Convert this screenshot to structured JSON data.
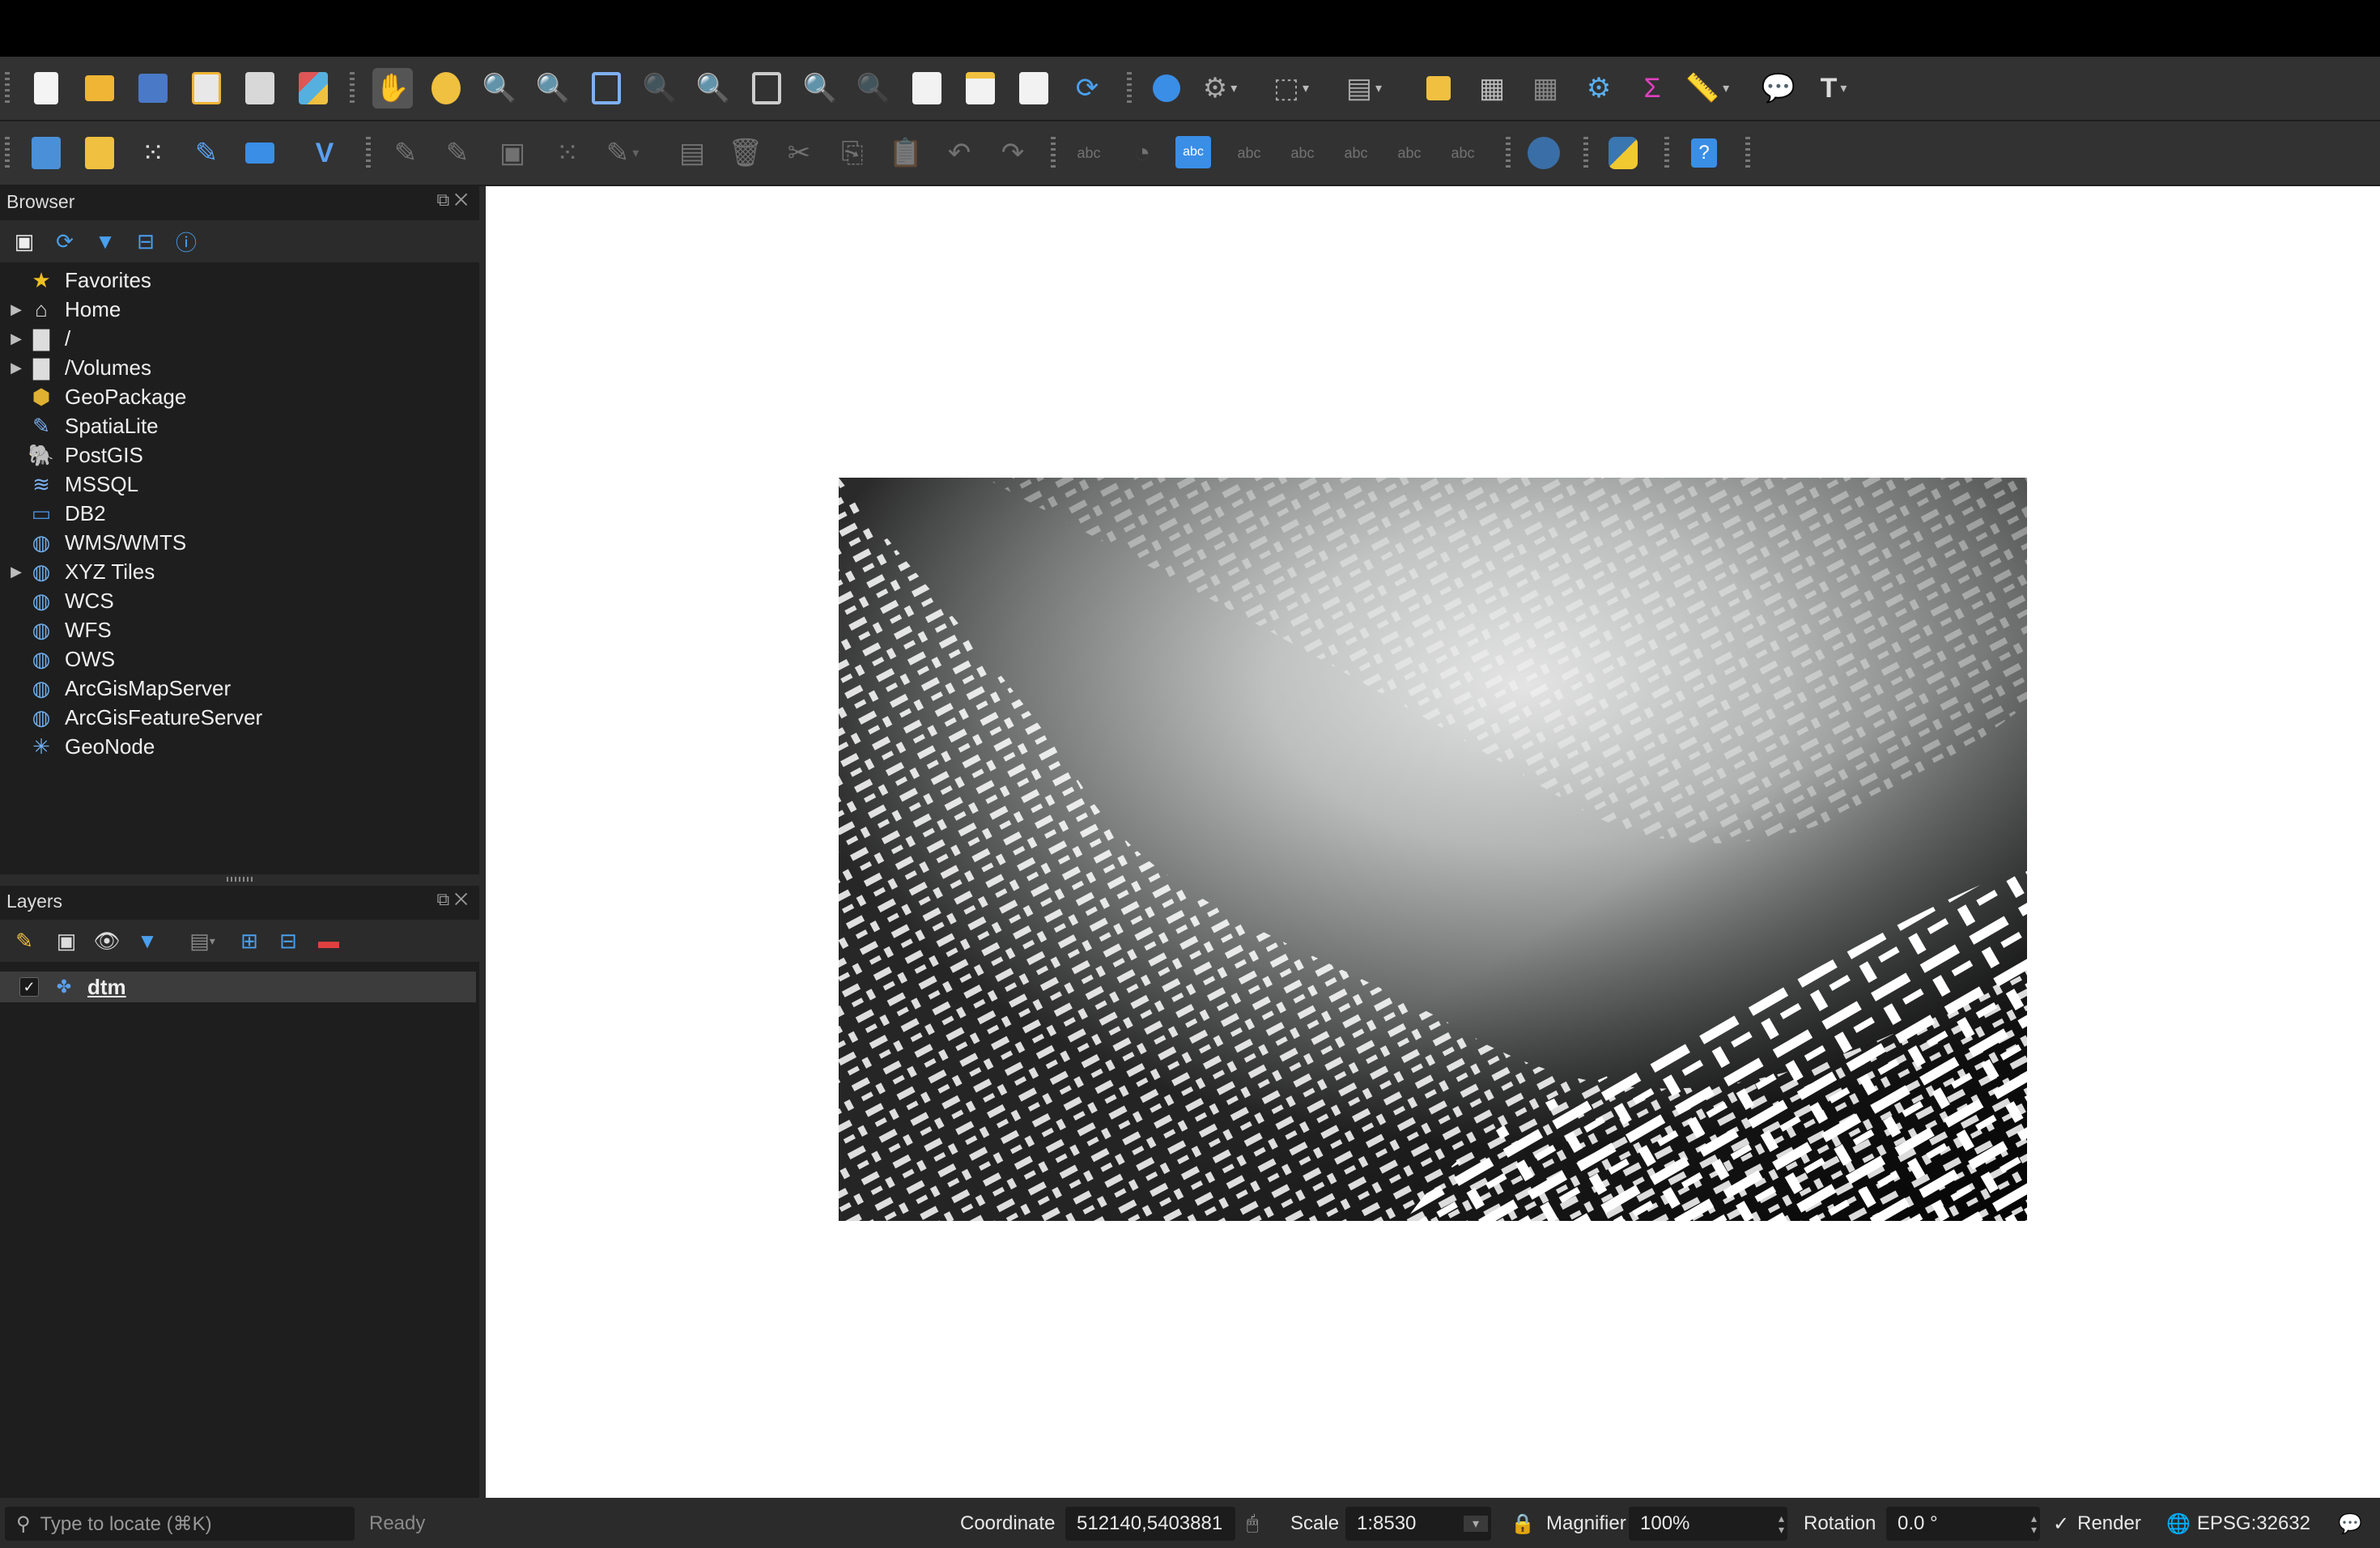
{
  "toolbar1": [
    {
      "name": "new-project",
      "label": "New Project"
    },
    {
      "name": "open-project",
      "label": "Open Project"
    },
    {
      "name": "save-project",
      "label": "Save Project"
    },
    {
      "name": "new-print-layout",
      "label": "New Print Layout"
    },
    {
      "name": "show-layout-manager",
      "label": "Show Layout Manager"
    },
    {
      "name": "style-manager",
      "label": "Style Manager"
    },
    {
      "name": "pan-map",
      "label": "Pan Map"
    },
    {
      "name": "pan-to-selection",
      "label": "Pan Map to Selection"
    },
    {
      "name": "zoom-in",
      "label": "Zoom In"
    },
    {
      "name": "zoom-out",
      "label": "Zoom Out"
    },
    {
      "name": "zoom-full",
      "label": "Zoom Full"
    },
    {
      "name": "zoom-to-selection",
      "label": "Zoom to Selection"
    },
    {
      "name": "zoom-to-layer",
      "label": "Zoom to Layer"
    },
    {
      "name": "zoom-native",
      "label": "Zoom to Native Resolution"
    },
    {
      "name": "zoom-last",
      "label": "Zoom Last"
    },
    {
      "name": "zoom-next",
      "label": "Zoom Next"
    },
    {
      "name": "new-map-view",
      "label": "New Map View"
    },
    {
      "name": "new-bookmark",
      "label": "New Spatial Bookmark"
    },
    {
      "name": "show-bookmarks",
      "label": "Show Spatial Bookmarks"
    },
    {
      "name": "refresh",
      "label": "Refresh"
    },
    {
      "name": "identify-features",
      "label": "Identify Features"
    },
    {
      "name": "run-feature-action",
      "label": "Run Feature Action"
    },
    {
      "name": "select-features",
      "label": "Select Features"
    },
    {
      "name": "select-by-value",
      "label": "Select by Value"
    },
    {
      "name": "deselect-all",
      "label": "Deselect Features"
    },
    {
      "name": "attribute-table",
      "label": "Open Attribute Table"
    },
    {
      "name": "field-calculator",
      "label": "Open Field Calculator"
    },
    {
      "name": "processing-toolbox",
      "label": "Toolbox"
    },
    {
      "name": "statistical-summary",
      "label": "Show Statistical Summary"
    },
    {
      "name": "measure-line",
      "label": "Measure Line"
    },
    {
      "name": "map-tips",
      "label": "Show Map Tips"
    },
    {
      "name": "text-annotation",
      "label": "Text Annotation"
    }
  ],
  "browser": {
    "title": "Browser",
    "items": [
      {
        "label": "Favorites",
        "icon": "star-icon",
        "expandable": false
      },
      {
        "label": "Home",
        "icon": "home-icon",
        "expandable": true
      },
      {
        "label": "/",
        "icon": "folder-icon",
        "expandable": true
      },
      {
        "label": "/Volumes",
        "icon": "folder-icon",
        "expandable": true
      },
      {
        "label": "GeoPackage",
        "icon": "geopackage-icon",
        "expandable": false
      },
      {
        "label": "SpatiaLite",
        "icon": "spatialite-icon",
        "expandable": false
      },
      {
        "label": "PostGIS",
        "icon": "postgis-icon",
        "expandable": false
      },
      {
        "label": "MSSQL",
        "icon": "mssql-icon",
        "expandable": false
      },
      {
        "label": "DB2",
        "icon": "db2-icon",
        "expandable": false
      },
      {
        "label": "WMS/WMTS",
        "icon": "globe-icon",
        "expandable": false
      },
      {
        "label": "XYZ Tiles",
        "icon": "globe-icon",
        "expandable": true
      },
      {
        "label": "WCS",
        "icon": "wcs-icon",
        "expandable": false
      },
      {
        "label": "WFS",
        "icon": "wfs-icon",
        "expandable": false
      },
      {
        "label": "OWS",
        "icon": "ows-icon",
        "expandable": false
      },
      {
        "label": "ArcGisMapServer",
        "icon": "arcgis-map-icon",
        "expandable": false
      },
      {
        "label": "ArcGisFeatureServer",
        "icon": "arcgis-feature-icon",
        "expandable": false
      },
      {
        "label": "GeoNode",
        "icon": "geonode-icon",
        "expandable": false
      }
    ]
  },
  "layers": {
    "title": "Layers",
    "items": [
      {
        "label": "dtm",
        "checked": true
      }
    ]
  },
  "status": {
    "locate_placeholder": "Type to locate (⌘K)",
    "ready": "Ready",
    "coordinate_label": "Coordinate",
    "coordinate_value": "512140,5403881",
    "scale_label": "Scale",
    "scale_value": "1:8530",
    "magnifier_label": "Magnifier",
    "magnifier_value": "100%",
    "rotation_label": "Rotation",
    "rotation_value": "0.0 °",
    "render_label": "Render",
    "render_checked": true,
    "crs": "EPSG:32632"
  },
  "colors": {
    "accent_blue": "#3a8ee6",
    "toolbar_bg": "#323232",
    "panel_bg": "#1e1e1e"
  }
}
